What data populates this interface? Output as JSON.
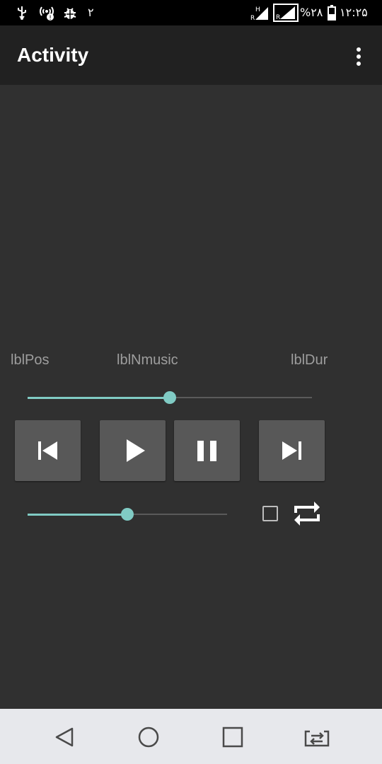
{
  "status_bar": {
    "sim_number": "۲",
    "network_h": "H",
    "network_r": "R",
    "battery_percent": "%۲۸",
    "time": "۱۲:۲۵"
  },
  "app_bar": {
    "title": "Activity",
    "overflow_icon": "more-vert-icon"
  },
  "player": {
    "position_label": "lblPos",
    "music_name_label": "lblNmusic",
    "duration_label": "lblDur",
    "seek_progress": 0.5,
    "volume_progress": 0.5,
    "buttons": {
      "previous_icon": "skip-previous-icon",
      "play_icon": "play-icon",
      "pause_icon": "pause-icon",
      "next_icon": "skip-next-icon"
    },
    "checkbox_checked": false,
    "repeat_icon": "repeat-icon"
  },
  "navigation_bar": {
    "back_icon": "back-icon",
    "home_icon": "home-icon",
    "recents_icon": "recents-icon",
    "switch_icon": "switch-app-icon"
  },
  "colors": {
    "accent": "#80cbc4",
    "background": "#303030",
    "app_bar": "#212121",
    "button": "#585858"
  }
}
